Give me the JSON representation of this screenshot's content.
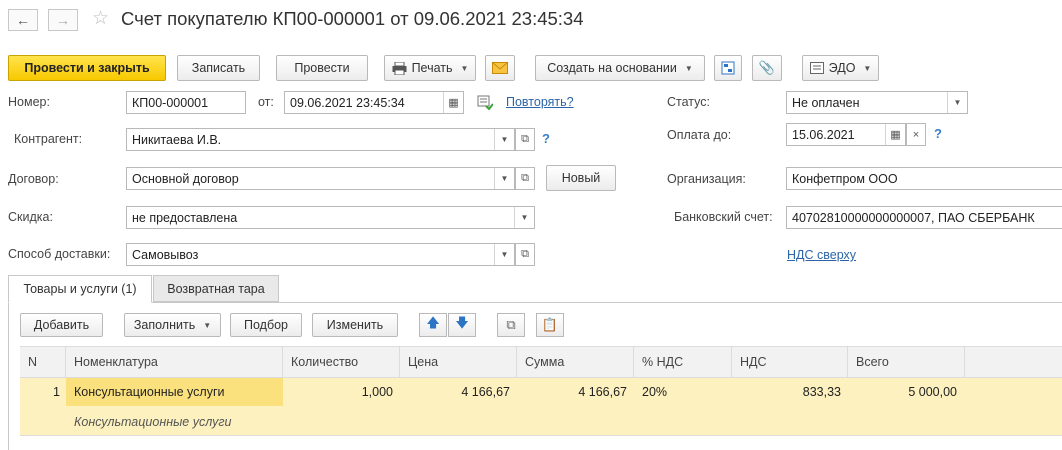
{
  "window": {
    "title": "Счет покупателю КП00-000001 от 09.06.2021 23:45:34",
    "back_icon": "←",
    "forward_icon": "→",
    "star_icon": "☆"
  },
  "toolbar": {
    "post_close": "Провести и закрыть",
    "save": "Записать",
    "post": "Провести",
    "print": "Печать",
    "create_based": "Создать на основании",
    "edo": "ЭДО"
  },
  "form": {
    "number_label": "Номер:",
    "number_value": "КП00-000001",
    "date_label": "от:",
    "date_value": "09.06.2021 23:45:34",
    "repeat_link": "Повторять?",
    "status_label": "Статус:",
    "status_value": "Не оплачен",
    "counterparty_label": "Контрагент:",
    "counterparty_value": "Никитаева И.В.",
    "pay_until_label": "Оплата до:",
    "pay_until_value": "15.06.2021",
    "contract_label": "Договор:",
    "contract_value": "Основной договор",
    "new_button": "Новый",
    "organization_label": "Организация:",
    "organization_value": "Конфетпром ООО",
    "discount_label": "Скидка:",
    "discount_value": "не предоставлена",
    "bank_account_label": "Банковский счет:",
    "bank_account_value": "40702810000000000007, ПАО СБЕРБАНК",
    "delivery_label": "Способ доставки:",
    "delivery_value": "Самовывоз",
    "vat_link": "НДС сверху",
    "help": "?"
  },
  "tabs": [
    {
      "label": "Товары и услуги (1)",
      "active": true
    },
    {
      "label": "Возвратная тара",
      "active": false
    }
  ],
  "table_toolbar": {
    "add": "Добавить",
    "fill": "Заполнить",
    "pick": "Подбор",
    "change": "Изменить"
  },
  "table": {
    "columns": [
      "N",
      "Номенклатура",
      "Количество",
      "Цена",
      "Сумма",
      "% НДС",
      "НДС",
      "Всего"
    ],
    "rows": [
      {
        "n": "1",
        "item": "Консультационные услуги",
        "item_sub": "Консультационные услуги",
        "qty": "1,000",
        "price": "4 166,67",
        "sum": "4 166,67",
        "vat_rate": "20%",
        "vat": "833,33",
        "total": "5 000,00"
      }
    ]
  },
  "colors": {
    "primary_button": "#f8c900",
    "selected_row": "#fdf1bf",
    "link": "#2b64a8"
  }
}
